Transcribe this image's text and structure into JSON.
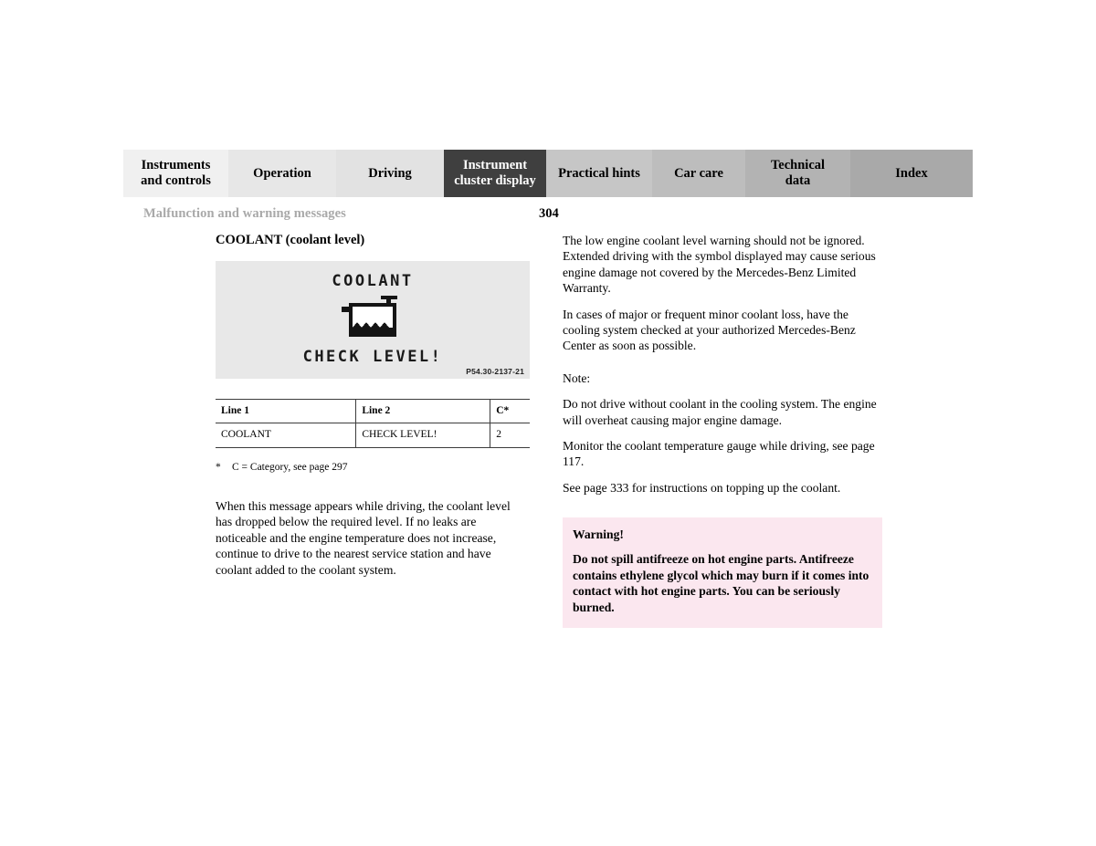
{
  "tabs": [
    {
      "label": "Instruments\nand controls",
      "name": "tab-instruments-and-controls",
      "bg": "#f0f0f0",
      "active": false
    },
    {
      "label": "Operation",
      "name": "tab-operation",
      "bg": "#e7e7e7",
      "active": false
    },
    {
      "label": "Driving",
      "name": "tab-driving",
      "bg": "#e2e2e2",
      "active": false
    },
    {
      "label": "Instrument\ncluster display",
      "name": "tab-instrument-cluster-display",
      "bg": "#3f3f3f",
      "active": true
    },
    {
      "label": "Practical hints",
      "name": "tab-practical-hints",
      "bg": "#c6c6c6",
      "active": false
    },
    {
      "label": "Car care",
      "name": "tab-car-care",
      "bg": "#bdbdbd",
      "active": false
    },
    {
      "label": "Technical\ndata",
      "name": "tab-technical-data",
      "bg": "#b3b3b3",
      "active": false
    },
    {
      "label": "Index",
      "name": "tab-index",
      "bg": "#a9a9a9",
      "active": false
    }
  ],
  "header": {
    "running_head": "Malfunction and warning messages",
    "page_number": "304",
    "running_head_color": "#a9a9a9"
  },
  "left_column": {
    "section_title": "COOLANT (coolant level)",
    "figure": {
      "lcd_line1": "COOLANT",
      "lcd_line2": "CHECK LEVEL!",
      "caption": "P54.30-2137-21",
      "background": "#e8e8e8",
      "symbol": "coolant-reservoir-low-level"
    },
    "table": {
      "headers": [
        "Line 1",
        "Line 2",
        "C*"
      ],
      "rows": [
        [
          "COOLANT",
          "CHECK LEVEL!",
          "2"
        ]
      ]
    },
    "footnote_marker": "*",
    "footnote": "C = Category, see page 297",
    "paragraphs": [
      "When this message appears while driving, the coolant level has dropped below the required level. If no leaks are noticeable and the engine temperature does not increase, continue to drive to the nearest service station and have coolant added to the coolant system."
    ]
  },
  "right_column": {
    "paragraphs": [
      "The low engine coolant level warning should not be ignored. Extended driving with the symbol displayed may cause serious engine damage not covered by the Mercedes-Benz Limited Warranty.",
      "In cases of major or frequent minor coolant loss, have the cooling system checked at your authorized Mercedes-Benz Center as soon as possible."
    ],
    "note_label": "Note:",
    "note_paragraphs": [
      "Do not drive without coolant in the cooling system. The engine will overheat causing major engine damage.",
      "Monitor the coolant temperature gauge while driving, see page 117.",
      "See page 333 for instructions on topping up the coolant."
    ],
    "warning": {
      "title": "Warning!",
      "text": "Do not spill antifreeze on hot engine parts. Antifreeze contains ethylene glycol which may burn if it comes into contact with hot engine parts. You can be seriously burned.",
      "background": "#fbe7ef"
    }
  }
}
